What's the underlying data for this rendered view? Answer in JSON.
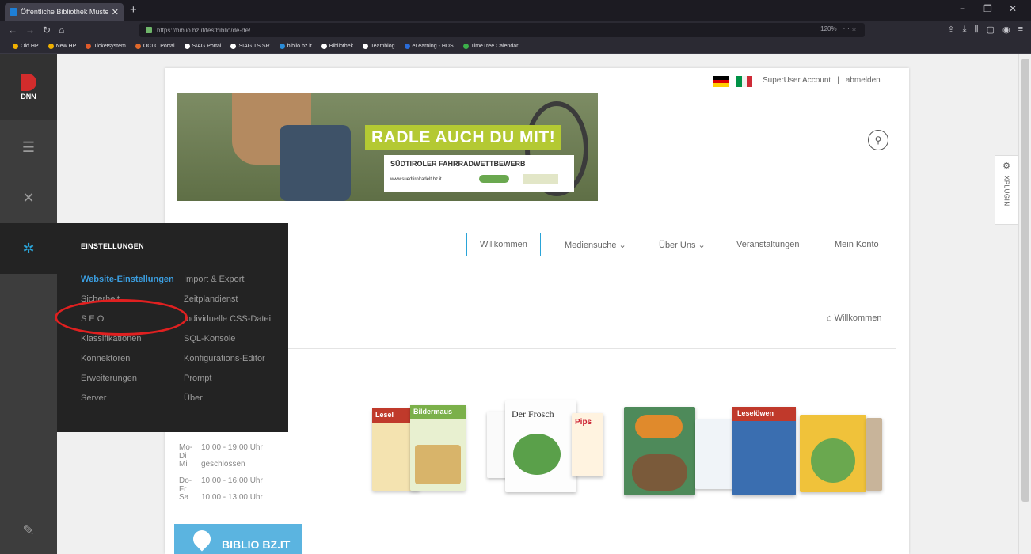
{
  "browser": {
    "tab_title": "Öffentliche Bibliothek Muste...",
    "tab_close": "✕",
    "new_tab": "+",
    "url": "https://biblio.bz.it/testbiblio/de-de/",
    "zoom": "120%",
    "url_actions": "···  ☆",
    "bookmarks": [
      "Old HP",
      "New HP",
      "Ticketsystem",
      "OCLC Portal",
      "SIAG Portal",
      "SIAG TS SR",
      "biblio.bz.it",
      "Bibliothek",
      "Teamblog",
      "eLearning - HDS",
      "TimeTree Calendar"
    ],
    "bookmark_colors": [
      "#f0b000",
      "#f0b000",
      "#e05a2a",
      "#e0682a",
      "#ffffff",
      "#ffffff",
      "#2a8cd8",
      "#ffffff",
      "#ffffff",
      "#2a6cd8",
      "#3cb04a"
    ]
  },
  "persona_bar": {
    "logo_text": "DNN"
  },
  "flyout": {
    "title": "EINSTELLUNGEN",
    "col1": [
      "Website-Einstellungen",
      "Sicherheit",
      "S E O",
      "Klassifikationen",
      "Konnektoren",
      "Erweiterungen",
      "Server"
    ],
    "col2": [
      "Import & Export",
      "Zeitplandienst",
      "Individuelle CSS-Datei",
      "SQL-Konsole",
      "Konfigurations-Editor",
      "Prompt",
      "Über"
    ]
  },
  "header": {
    "account": "SuperUser Account",
    "separator": "|",
    "logout": "abmelden"
  },
  "banner": {
    "headline": "RADLE AUCH DU MIT!",
    "subline": "SÜDTIROLER FAHRRADWETTBEWERB",
    "url": "www.suedtirolradelt.bz.it"
  },
  "menu": {
    "items": [
      "Willkommen",
      "Mediensuche",
      "Über Uns",
      "Veranstaltungen",
      "Mein Konto"
    ],
    "dropdown_marker": "⌄"
  },
  "breadcrumb": {
    "label": "Willkommen"
  },
  "hours": [
    {
      "day": "Mo-Di",
      "time": "10:00 - 19:00 Uhr"
    },
    {
      "day": "Mi",
      "time": "geschlossen"
    },
    {
      "day": "Do-Fr",
      "time": "10:00 - 16:00 Uhr"
    },
    {
      "day": "Sa",
      "time": "10:00 - 13:00 Uhr"
    }
  ],
  "books": {
    "frog_title": "Der Frosch",
    "book1": "Lesel",
    "book2": "Bildermaus",
    "book3": "Pips",
    "book4": "Leselöwen"
  },
  "badge": {
    "text": "BIBLIO BZ.IT"
  },
  "xplugin": {
    "label": "XPLUGIN"
  }
}
